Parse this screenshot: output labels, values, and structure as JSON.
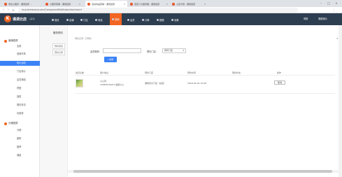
{
  "browser": {
    "tabs": [
      {
        "label": "学生小程序 - 课调运营"
      },
      {
        "label": "小程序营销 - 课调运营"
      },
      {
        "label": "活动商品营销 - 课调运营"
      },
      {
        "label": "自定义分类管理 - 课调运营"
      },
      {
        "label": "小店卡营 - 课调运营"
      }
    ],
    "url": "mcp.kemenpuo.com/ComponentMobSubscribe/record"
  },
  "topnav": {
    "logo_text": "课调云店",
    "logo_badge": "K",
    "logo_sub": "(演示)",
    "items": [
      {
        "label": "首页"
      },
      {
        "label": "店铺"
      },
      {
        "label": "门店"
      },
      {
        "label": "商品"
      },
      {
        "label": "营销"
      },
      {
        "label": "会员"
      },
      {
        "label": "订单"
      },
      {
        "label": "数据"
      },
      {
        "label": "设置"
      }
    ],
    "right_items": [
      {
        "label": "帮助"
      },
      {
        "label": "课调演示"
      }
    ]
  },
  "sidebar": {
    "group1": "营销插件",
    "items": [
      {
        "label": "全部"
      },
      {
        "label": "营销市场"
      },
      {
        "label": "砍价活动"
      },
      {
        "label": "门店特价"
      },
      {
        "label": "会员满减"
      },
      {
        "label": "拼团"
      },
      {
        "label": "抽奖"
      },
      {
        "label": "限时折扣"
      },
      {
        "label": "优惠券"
      }
    ],
    "group2": "分销插件",
    "items2": [
      {
        "label": "分销"
      },
      {
        "label": "团购"
      },
      {
        "label": "推荐"
      },
      {
        "label": "储值"
      }
    ]
  },
  "subnav": {
    "title": "服务预约",
    "items": [
      {
        "label": "预约项目"
      },
      {
        "label": "预约记录"
      }
    ]
  },
  "content": {
    "breadcrumb": "预约记录 / 已预约",
    "close_label": "✕",
    "form": {
      "nickname_label": "会员昵称：",
      "nickname_value": "",
      "store_label": "预约门店：",
      "store_value": "所有门店",
      "search_label": "搜索"
    },
    "table": {
      "headers": [
        "会员头像",
        "客户信息",
        "预约门店",
        "预约时间",
        "预约状态",
        "操作"
      ],
      "rows": [
        {
          "name": "小心同",
          "phone": "15683576253 蓝颜小心",
          "store": "课调支付门店（总店）",
          "time": "2018-05-16 14:08",
          "status": "",
          "action": "取消"
        }
      ]
    }
  }
}
